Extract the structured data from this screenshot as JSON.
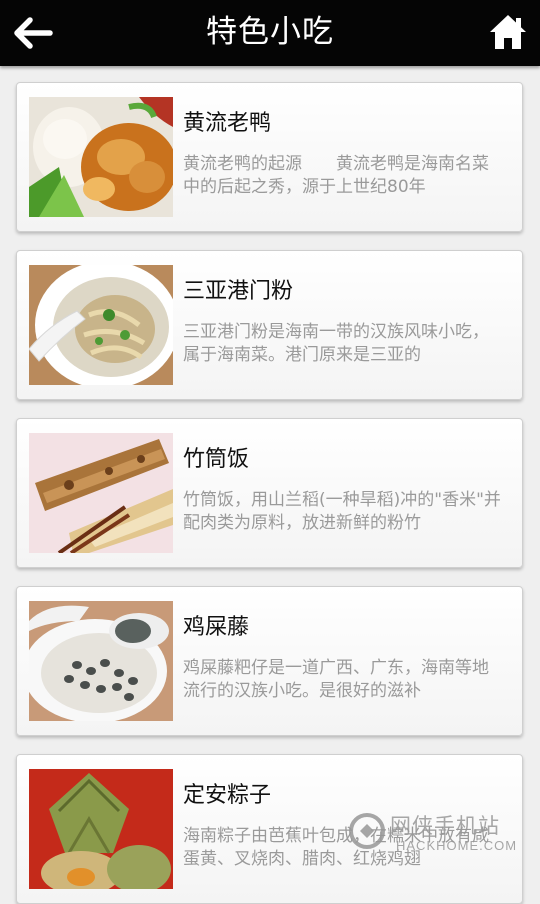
{
  "header": {
    "title": "特色小吃",
    "back_icon": "back-arrow-icon",
    "home_icon": "home-icon"
  },
  "items": [
    {
      "title": "黄流老鸭",
      "desc": "黄流老鸭的起源　　黄流老鸭是海南名菜中的后起之秀，源于上世纪80年",
      "image": "duck-rice-dish"
    },
    {
      "title": "三亚港门粉",
      "desc": "三亚港门粉是海南一带的汉族风味小吃，属于海南菜。港门原来是三亚的",
      "image": "noodle-soup-bowl"
    },
    {
      "title": "竹筒饭",
      "desc": "竹筒饭，用山兰稻(一种旱稻)冲的\"香米\"并配肉类为原料，放进新鲜的粉竹",
      "image": "bamboo-rice"
    },
    {
      "title": "鸡屎藤",
      "desc": "鸡屎藤粑仔是一道广西、广东，海南等地流行的汉族小吃。是很好的滋补",
      "image": "dumpling-dessert-bowl"
    },
    {
      "title": "定安粽子",
      "desc": "海南粽子由芭蕉叶包成，在糯米中放有咸蛋黄、叉烧肉、腊肉、红烧鸡翅",
      "image": "zongzi"
    }
  ],
  "watermark": {
    "main": "网侠手机站",
    "sub": "HACKHOME.COM"
  },
  "colors": {
    "topbar": "#050505",
    "background": "#efefef",
    "title_text": "#111111",
    "desc_text": "#9a9a9a"
  }
}
